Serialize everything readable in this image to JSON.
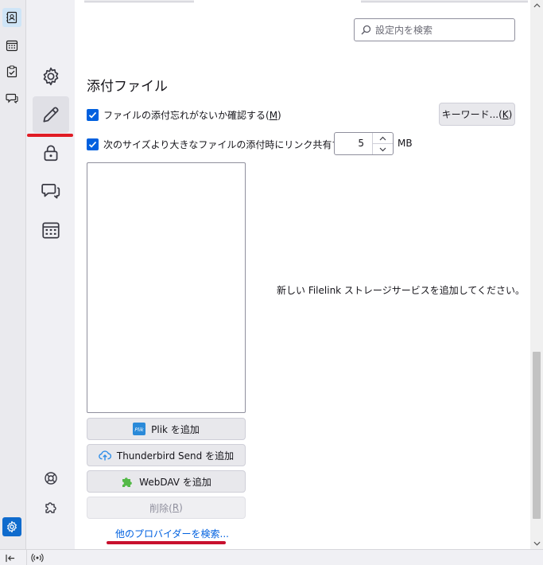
{
  "search": {
    "placeholder": "設定内を検索"
  },
  "section": {
    "title": "添付ファイル"
  },
  "options": {
    "forgotten_attachment": {
      "label": "ファイルの添付忘れがないか確認する(",
      "accesskey": "M",
      "suffix": ")",
      "checked": true
    },
    "keyword_button": {
      "label": "キーワード...(",
      "accesskey": "K",
      "suffix": ")"
    },
    "filelink_threshold": {
      "label": "次のサイズより大きなファイルの添付時にリンク共有する:",
      "checked": true,
      "value": "5",
      "unit": "MB"
    }
  },
  "filelink": {
    "empty_message": "新しい Filelink ストレージサービスを追加してください。",
    "add_buttons": [
      {
        "label": "Plik を追加",
        "icon": "plik-icon"
      },
      {
        "label": "Thunderbird Send を追加",
        "icon": "cloud-upload-icon"
      },
      {
        "label": "WebDAV を追加",
        "icon": "puzzle-icon"
      }
    ],
    "remove_button": {
      "label": "削除(",
      "accesskey": "R",
      "suffix": ")"
    },
    "find_providers_link": "他のプロバイダーを検索...",
    "plik_logo_text": "Plik"
  },
  "colors": {
    "accent": "#0060df",
    "link": "#0061e0",
    "annotation_red": "#e01b24",
    "settings_space": "#0f6bcd"
  },
  "spaces_icons": [
    "address-book-icon",
    "calendar-icon",
    "tasks-icon",
    "chat-icon",
    "settings-icon",
    "collapse-icon"
  ],
  "category_icons": [
    "gear-icon",
    "pencil-icon",
    "lock-icon",
    "chat-bubbles-icon",
    "calendar-grid-icon",
    "help-icon",
    "addons-icon"
  ]
}
